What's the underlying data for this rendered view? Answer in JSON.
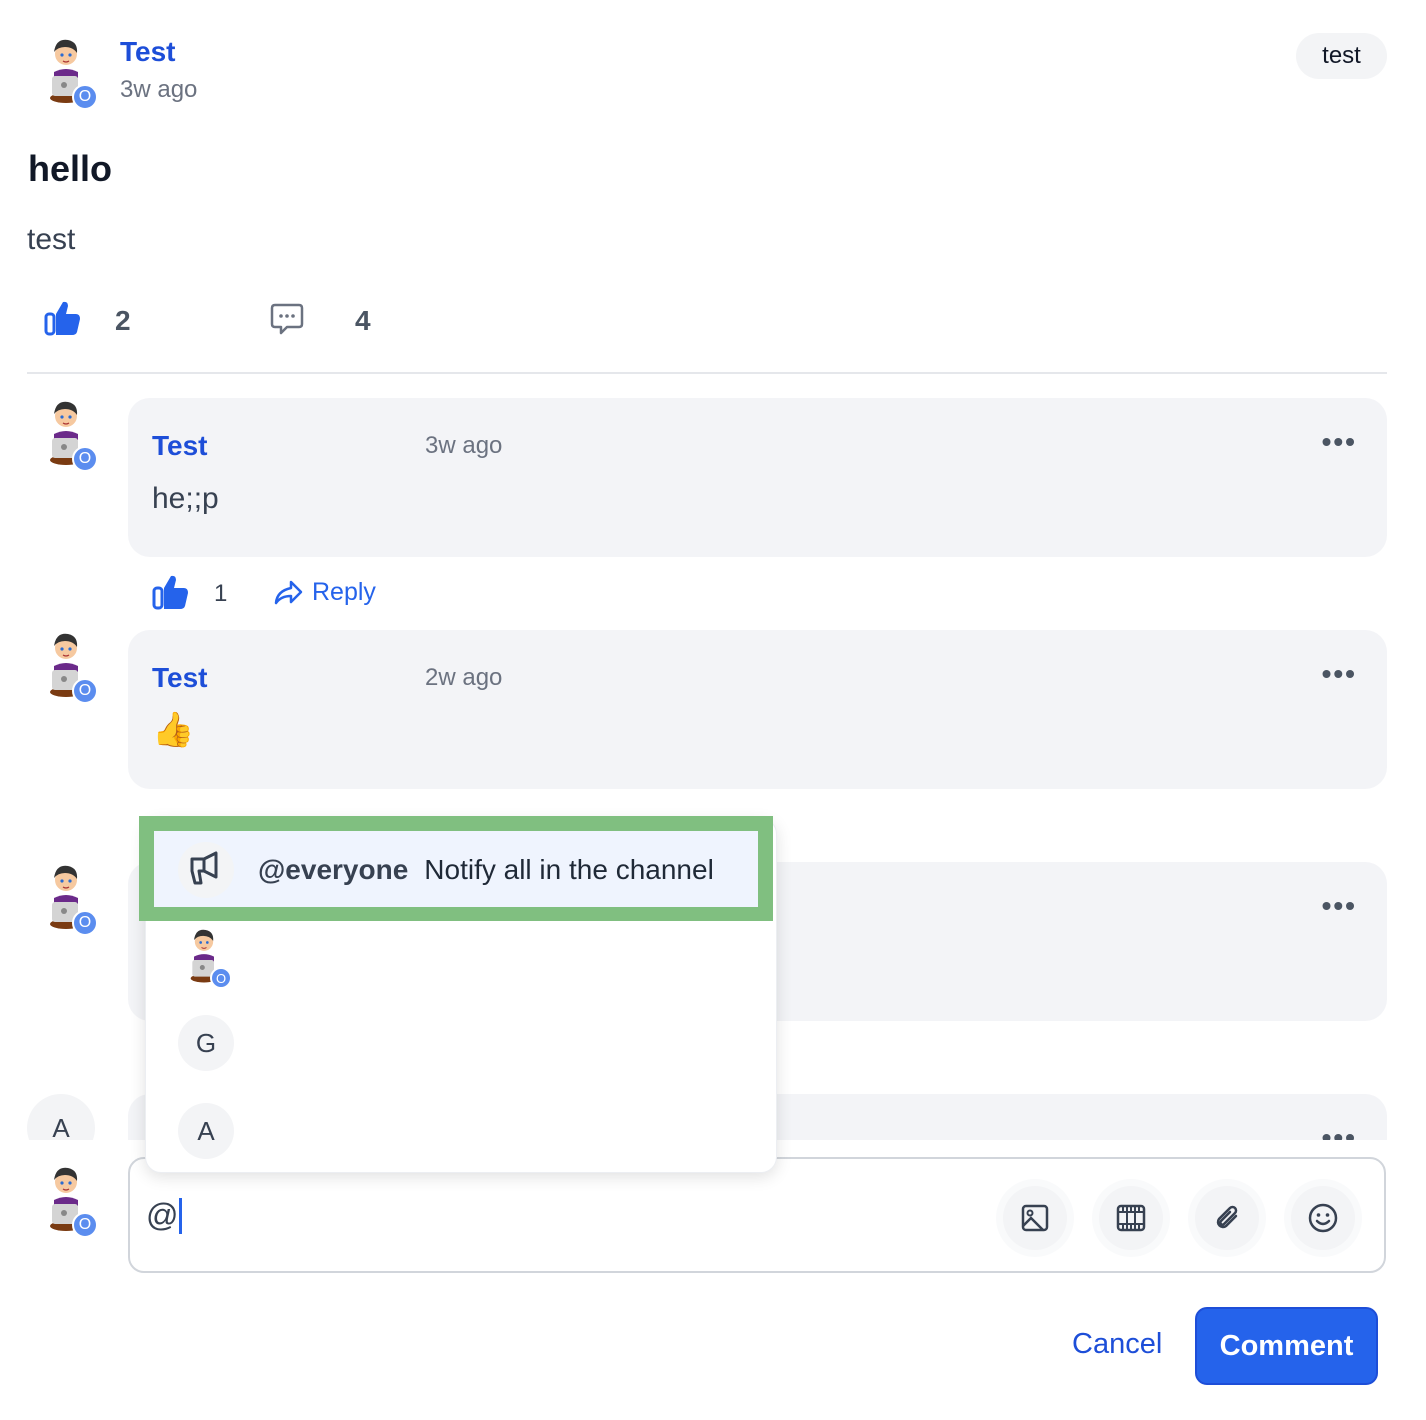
{
  "post": {
    "author": "Test",
    "time": "3w ago",
    "tag": "test",
    "title": "hello",
    "body": "test",
    "likes": "2",
    "comments_count": "4",
    "avatar_badge": "O"
  },
  "comments": [
    {
      "author": "Test",
      "time": "3w ago",
      "text": "he;;p",
      "likes": "1",
      "reply_label": "Reply",
      "avatar_badge": "O"
    },
    {
      "author": "Test",
      "time": "2w ago",
      "text": "👍",
      "avatar_badge": "O"
    },
    {
      "avatar_badge": "O"
    },
    {
      "avatar_letter": "A"
    }
  ],
  "mention_popup": {
    "everyone_handle": "@everyone",
    "everyone_desc": "Notify all in the channel",
    "items": [
      {
        "avatar_badge": "O"
      },
      {
        "avatar_letter": "G"
      },
      {
        "avatar_letter": "A"
      }
    ],
    "highlight_color": "#80bf80"
  },
  "composer": {
    "value": "@",
    "avatar_badge": "O",
    "tools": [
      "image-icon",
      "video-icon",
      "attachment-icon",
      "emoji-icon"
    ],
    "cancel_label": "Cancel",
    "submit_label": "Comment"
  },
  "colors": {
    "accent": "#2563eb",
    "link": "#1d4ed8"
  }
}
